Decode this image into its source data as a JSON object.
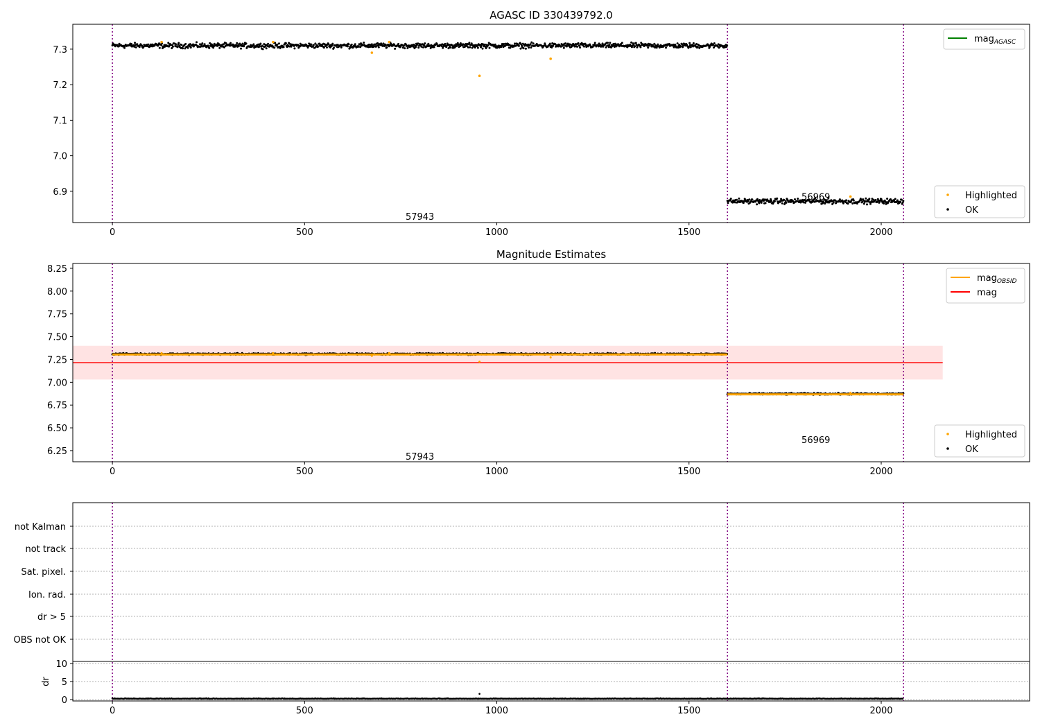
{
  "chart_data": [
    {
      "type": "scatter",
      "title": "AGASC ID 330439792.0",
      "xlim": [
        -103,
        2386
      ],
      "ylim": [
        6.812,
        7.37
      ],
      "xticks": [
        0,
        500,
        1000,
        1500,
        2000
      ],
      "yticks": [
        6.9,
        7.0,
        7.1,
        7.2,
        7.3
      ],
      "segments": [
        {
          "label": "57943",
          "x_range": [
            0,
            1600
          ],
          "mag": 7.31,
          "scatter": 0.005
        },
        {
          "label": "56969",
          "x_range": [
            1600,
            2058
          ],
          "mag": 6.872,
          "scatter": 0.005
        }
      ],
      "highlighted": [
        [
          128,
          7.32
        ],
        [
          418,
          7.32
        ],
        [
          675,
          7.29
        ],
        [
          720,
          7.32
        ],
        [
          955,
          7.225
        ],
        [
          1140,
          7.273
        ],
        [
          1920,
          6.885
        ]
      ],
      "obsid_boundaries": [
        0,
        1600,
        2058
      ],
      "segment_labels": [
        {
          "text": "57943",
          "x": 800,
          "y": 6.83
        },
        {
          "text": "56969",
          "x": 1830,
          "y": 6.885
        }
      ],
      "legend_lines": [
        {
          "name": "mag",
          "sub": "AGASC",
          "color": "#008000"
        }
      ],
      "legend_points": [
        {
          "name": "Highlighted",
          "color": "#ffa500"
        },
        {
          "name": "OK",
          "color": "#000000"
        }
      ]
    },
    {
      "type": "scatter",
      "title": "Magnitude Estimates",
      "xlim": [
        -103,
        2386
      ],
      "ylim": [
        6.128,
        8.303
      ],
      "xticks": [
        0,
        500,
        1000,
        1500,
        2000
      ],
      "yticks": [
        6.25,
        6.5,
        6.75,
        7.0,
        7.25,
        7.5,
        7.75,
        8.0,
        8.25
      ],
      "mag": 7.215,
      "mag_band": [
        7.03,
        7.4
      ],
      "mag_extent": [
        -103,
        2160
      ],
      "obsid_mag": [
        {
          "x_range": [
            0,
            1600
          ],
          "mag": 7.305
        },
        {
          "x_range": [
            1600,
            2058
          ],
          "mag": 6.868
        }
      ],
      "segment_labels": [
        {
          "text": "57943",
          "x": 800,
          "y": 6.19
        },
        {
          "text": "56969",
          "x": 1830,
          "y": 6.37
        }
      ],
      "legend_lines": [
        {
          "name": "mag",
          "sub": "OBSID",
          "color": "#ffa500"
        },
        {
          "name": "mag",
          "sub": "",
          "color": "#ff0000"
        }
      ],
      "legend_points": [
        {
          "name": "Highlighted",
          "color": "#ffa500"
        },
        {
          "name": "OK",
          "color": "#000000"
        }
      ]
    },
    {
      "type": "scatter",
      "flags": [
        "not Kalman",
        "not track",
        "Sat. pixel.",
        "Ion. rad.",
        "dr > 5",
        "OBS not OK"
      ],
      "ylabel": "dr",
      "ylim": [
        -0.38,
        10.58
      ],
      "yticks": [
        0,
        5,
        10
      ],
      "xticks": [
        0,
        500,
        1000,
        1500,
        2000
      ],
      "dr_typical": 0.2,
      "dr_outlier": [
        955,
        1.6
      ]
    }
  ]
}
